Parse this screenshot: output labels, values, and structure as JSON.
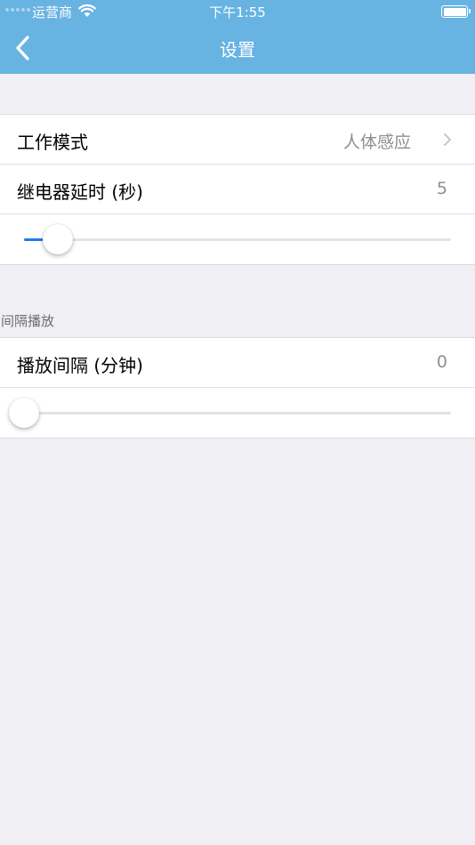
{
  "status_bar": {
    "carrier": "运营商",
    "time": "下午1:55"
  },
  "nav": {
    "title": "设置",
    "back_icon": "chevron-left-icon"
  },
  "groups": [
    {
      "rows": {
        "work_mode": {
          "label": "工作模式",
          "value": "人体感应"
        },
        "relay_delay": {
          "label": "继电器延时 (秒)",
          "value": "5"
        }
      },
      "slider": {
        "fraction": 0.08
      }
    },
    {
      "header": "间隔播放",
      "rows": {
        "play_interval": {
          "label": "播放间隔 (分钟)",
          "value": "0"
        }
      },
      "slider": {
        "fraction": 0.0
      }
    }
  ],
  "colors": {
    "nav_background": "#67b3e2",
    "slider_accent": "#1d7cf2",
    "page_background": "#efeff4"
  }
}
